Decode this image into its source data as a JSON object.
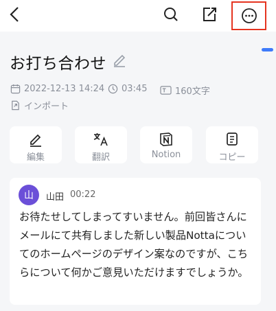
{
  "header": {
    "icons": [
      "back-arrow-icon",
      "search-icon",
      "export-icon",
      "more-icon"
    ]
  },
  "note": {
    "title": "お打ち合わせ",
    "date": "2022-12-13 14:24",
    "duration": "03:45",
    "char_count": "160文字",
    "source": "インポート"
  },
  "actions": [
    {
      "label": "編集",
      "icon": "pencil-icon"
    },
    {
      "label": "翻訳",
      "icon": "translate-icon"
    },
    {
      "label": "Notion",
      "icon": "notion-icon"
    },
    {
      "label": "コピー",
      "icon": "copy-icon"
    }
  ],
  "transcript": {
    "avatar": "山",
    "speaker": "山田",
    "time": "00:22",
    "text": "お待たせしてしまってすいません。前回皆さんにメールにて共有しました新しい製品Nottaについてのホームページのデザイン案なのですが、こちらについて何かご意見いただけますでしょうか。"
  },
  "colors": {
    "accent": "#3e7bfa",
    "avatar_bg": "#6b4fd8",
    "highlight_border": "#e5331f",
    "meta_text": "#8a8f99"
  }
}
